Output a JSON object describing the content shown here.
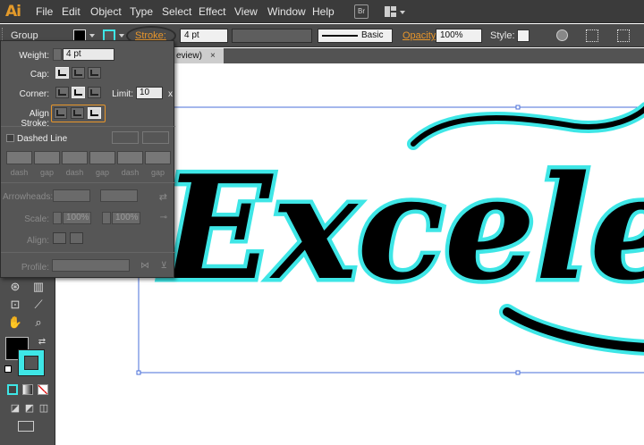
{
  "app": {
    "logo": "Ai"
  },
  "menu": [
    "File",
    "Edit",
    "Object",
    "Type",
    "Select",
    "Effect",
    "View",
    "Window",
    "Help"
  ],
  "control_bar": {
    "selection": "Group",
    "fill_color": "#000000",
    "stroke_color": "#3ee6e6",
    "stroke_label": "Stroke:",
    "stroke_weight": "4 pt",
    "brush_style": "Basic",
    "opacity_label": "Opacity:",
    "opacity_value": "100%",
    "style_label": "Style:"
  },
  "document_tab": {
    "title": "eview)",
    "close": "×"
  },
  "stroke_panel": {
    "weight_label": "Weight:",
    "weight_value": "4 pt",
    "cap_label": "Cap:",
    "corner_label": "Corner:",
    "limit_label": "Limit:",
    "limit_value": "10",
    "limit_unit": "x",
    "align_label": "Align Stroke:",
    "dashed_label": "Dashed Line",
    "dash_labels": [
      "dash",
      "gap",
      "dash",
      "gap",
      "dash",
      "gap"
    ],
    "arrowheads_label": "Arrowheads:",
    "scale_label": "Scale:",
    "scale_start": "100%",
    "scale_end": "100%",
    "align_arrow_label": "Align:",
    "profile_label": "Profile:"
  },
  "canvas": {
    "artwork_text": "Excele",
    "fill": "#000000",
    "stroke": "#3ee6e6"
  },
  "colors": {
    "accent_orange": "#e8962b",
    "stroke_cyan": "#3ee6e6",
    "selection_blue": "#4a6fd8"
  }
}
